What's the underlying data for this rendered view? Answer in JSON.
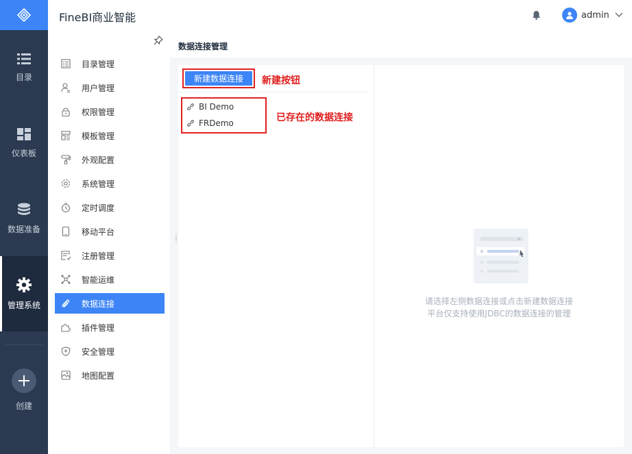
{
  "header": {
    "app_title": "FineBI商业智能",
    "user": "admin"
  },
  "rail": {
    "items": [
      {
        "label": "目录"
      },
      {
        "label": "仪表板"
      },
      {
        "label": "数据准备"
      },
      {
        "label": "管理系统"
      }
    ],
    "create_label": "创建"
  },
  "submenu": {
    "items": [
      {
        "label": "目录管理"
      },
      {
        "label": "用户管理"
      },
      {
        "label": "权限管理"
      },
      {
        "label": "模板管理"
      },
      {
        "label": "外观配置"
      },
      {
        "label": "系统管理"
      },
      {
        "label": "定时调度"
      },
      {
        "label": "移动平台"
      },
      {
        "label": "注册管理"
      },
      {
        "label": "智能运维"
      },
      {
        "label": "数据连接"
      },
      {
        "label": "插件管理"
      },
      {
        "label": "安全管理"
      },
      {
        "label": "地图配置"
      }
    ],
    "active": "数据连接"
  },
  "page": {
    "title": "数据连接管理"
  },
  "left_panel": {
    "new_button_label": "新建数据连接",
    "new_button_note": "新建按钮",
    "connections": [
      {
        "name": "BI Demo"
      },
      {
        "name": "FRDemo"
      }
    ],
    "connections_note": "已存在的数据连接"
  },
  "right_panel": {
    "empty_line1": "请选择左侧数据连接或点击新建数据连接",
    "empty_line2": "平台仅支持使用JDBC的数据连接的管理"
  },
  "colors": {
    "accent": "#3d85f6",
    "rail_bg": "#2b3a50",
    "annotation": "#e02020"
  }
}
